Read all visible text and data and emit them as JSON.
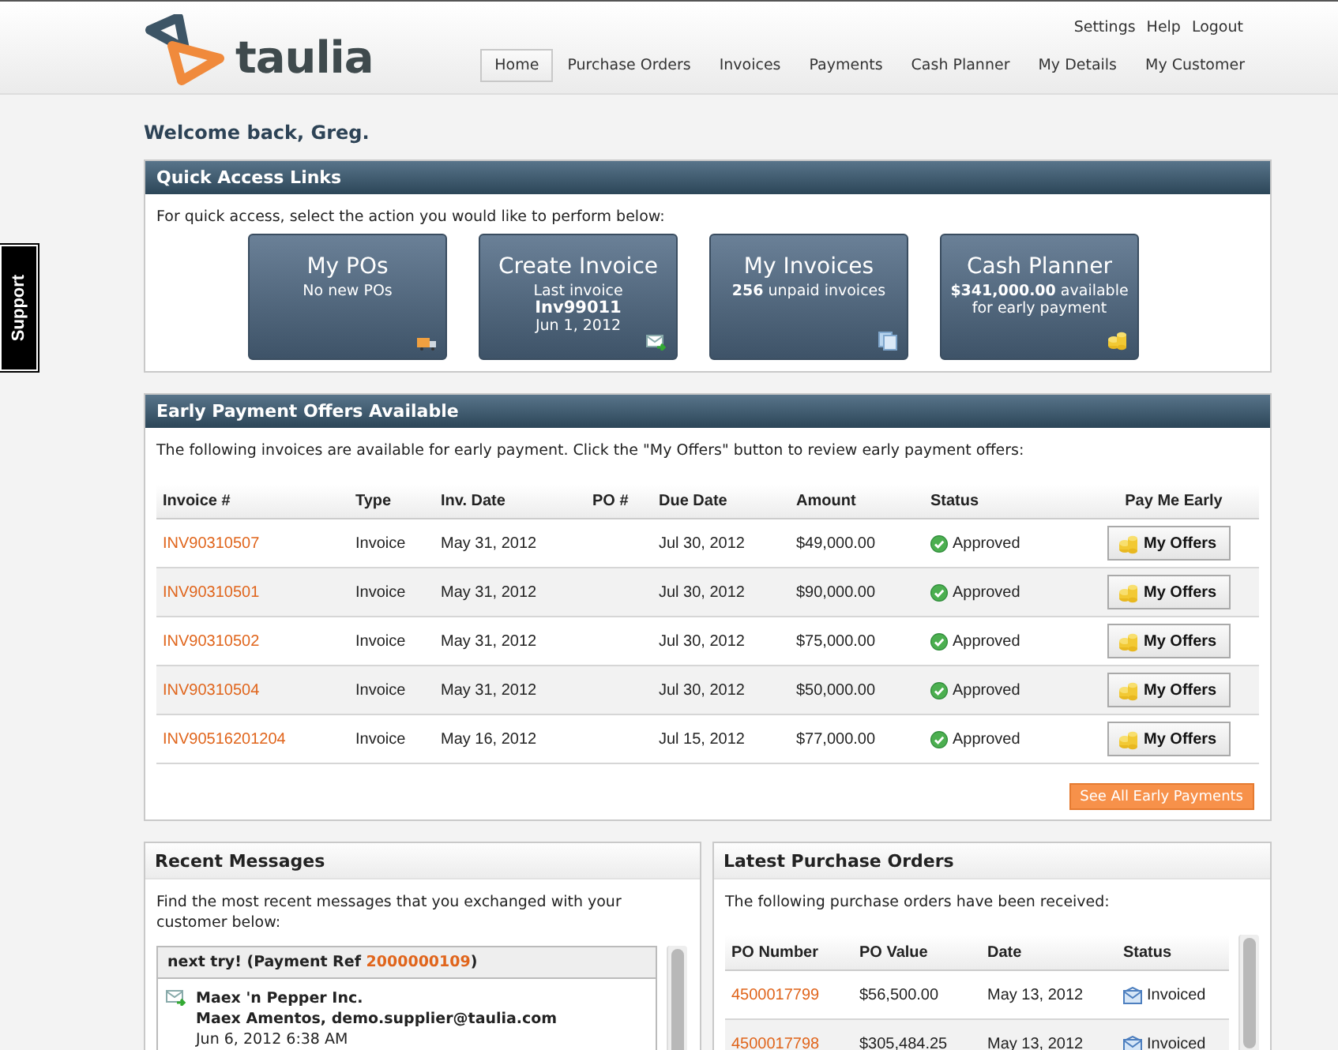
{
  "header": {
    "logo_text": "taulia",
    "utility_links": [
      "Settings",
      "Help",
      "Logout"
    ],
    "nav": [
      {
        "label": "Home",
        "selected": true
      },
      {
        "label": "Purchase Orders",
        "selected": false
      },
      {
        "label": "Invoices",
        "selected": false
      },
      {
        "label": "Payments",
        "selected": false
      },
      {
        "label": "Cash Planner",
        "selected": false
      },
      {
        "label": "My Details",
        "selected": false
      },
      {
        "label": "My Customer",
        "selected": false
      }
    ]
  },
  "support_tab": "Support",
  "welcome": "Welcome back, Greg.",
  "quick_access": {
    "title": "Quick Access Links",
    "description": "For quick access, select the action you would like to perform below:",
    "tiles": [
      {
        "title": "My POs",
        "lines": [
          {
            "text": "No new POs",
            "bold": false
          }
        ]
      },
      {
        "title": "Create Invoice",
        "lines": [
          {
            "text": "Last invoice",
            "bold": false
          },
          {
            "text": "Inv99011",
            "bold": true
          },
          {
            "text": "Jun 1, 2012",
            "bold": false
          }
        ]
      },
      {
        "title": "My Invoices",
        "lines": [
          {
            "text": "**256**  unpaid invoices",
            "bold": false
          }
        ]
      },
      {
        "title": "Cash Planner",
        "lines": [
          {
            "text": "**$341,000.00**  available",
            "bold": false
          },
          {
            "text": "for early payment",
            "bold": false
          }
        ]
      }
    ]
  },
  "early_payment": {
    "title": "Early Payment Offers Available",
    "description": "The following invoices are available for early payment. Click the \"My Offers\" button to review early payment offers:",
    "columns": [
      "Invoice #",
      "Type",
      "Inv. Date",
      "PO #",
      "Due Date",
      "Amount",
      "Status",
      "Pay Me Early"
    ],
    "rows": [
      {
        "invoice": "INV90310507",
        "type": "Invoice",
        "inv_date": "May 31, 2012",
        "po": "",
        "due_date": "Jul 30, 2012",
        "amount": "$49,000.00",
        "status": "Approved",
        "action": "My Offers"
      },
      {
        "invoice": "INV90310501",
        "type": "Invoice",
        "inv_date": "May 31, 2012",
        "po": "",
        "due_date": "Jul 30, 2012",
        "amount": "$90,000.00",
        "status": "Approved",
        "action": "My Offers"
      },
      {
        "invoice": "INV90310502",
        "type": "Invoice",
        "inv_date": "May 31, 2012",
        "po": "",
        "due_date": "Jul 30, 2012",
        "amount": "$75,000.00",
        "status": "Approved",
        "action": "My Offers"
      },
      {
        "invoice": "INV90310504",
        "type": "Invoice",
        "inv_date": "May 31, 2012",
        "po": "",
        "due_date": "Jul 30, 2012",
        "amount": "$50,000.00",
        "status": "Approved",
        "action": "My Offers"
      },
      {
        "invoice": "INV90516201204",
        "type": "Invoice",
        "inv_date": "May 16, 2012",
        "po": "",
        "due_date": "Jul 15, 2012",
        "amount": "$77,000.00",
        "status": "Approved",
        "action": "My Offers"
      }
    ],
    "see_all_button": "See All Early Payments"
  },
  "recent_messages": {
    "title": "Recent Messages",
    "description": "Find the most recent messages that you exchanged with your customer below:",
    "subject_prefix": "next try! (Payment Ref ",
    "payment_ref": "2000000109",
    "subject_suffix": ")",
    "message": {
      "company": "Maex 'n Pepper Inc.",
      "sender": "Maex Amentos, demo.supplier@taulia.com",
      "time": "Jun 6, 2012 6:38 AM"
    }
  },
  "latest_pos": {
    "title": "Latest Purchase Orders",
    "description": "The following purchase orders have been received:",
    "columns": [
      "PO Number",
      "PO Value",
      "Date",
      "Status"
    ],
    "rows": [
      {
        "po_number": "4500017799",
        "value": "$56,500.00",
        "date": "May 13, 2012",
        "status": "Invoiced"
      },
      {
        "po_number": "4500017798",
        "value": "$305,484.25",
        "date": "May 13, 2012",
        "status": "Invoiced"
      }
    ]
  }
}
